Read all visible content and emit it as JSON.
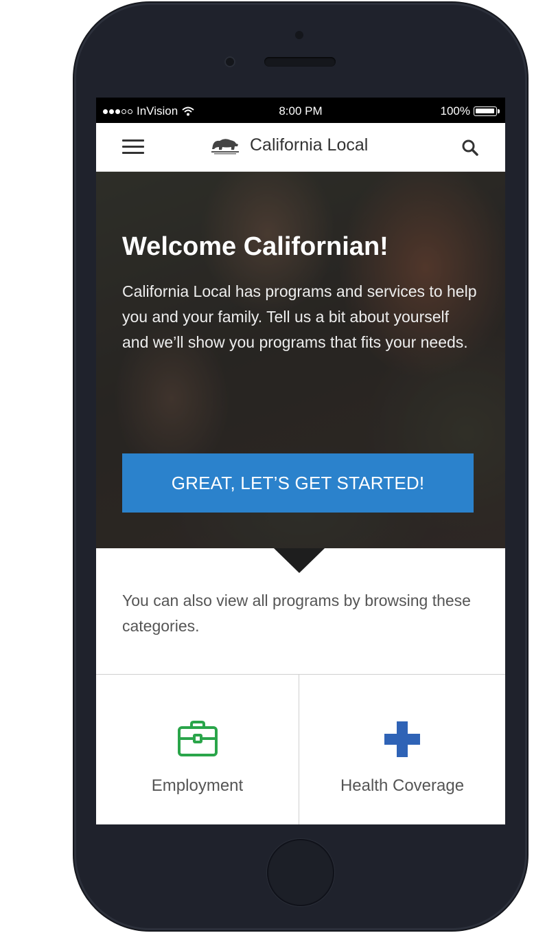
{
  "status_bar": {
    "carrier": "InVision",
    "time": "8:00 PM",
    "battery": "100%",
    "battery_level": 1.0,
    "signal_strength": 3
  },
  "header": {
    "title": "California Local",
    "menu_icon": "hamburger-menu-icon",
    "logo_icon": "california-bear-icon",
    "search_icon": "search-icon"
  },
  "hero": {
    "title": "Welcome Californian!",
    "body": "California Local has programs and services to help you and your family. Tell us a bit about yourself and we’ll show you programs that fits your needs.",
    "cta_label": "GREAT, LET’S GET STARTED!",
    "cta_color": "#2b82cc"
  },
  "browse": {
    "text": "You can also view all programs by browsing these categories."
  },
  "categories": [
    {
      "label": "Employment",
      "icon": "briefcase-icon",
      "color": "#2aa54a"
    },
    {
      "label": "Health Coverage",
      "icon": "medical-cross-icon",
      "color": "#2f63b6"
    }
  ]
}
